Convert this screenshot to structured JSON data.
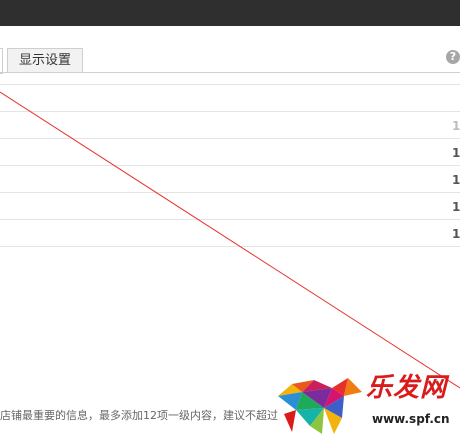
{
  "tabs": {
    "display_settings_label": "显示设置"
  },
  "help": {
    "glyph": "?"
  },
  "rows": [
    {
      "number": "1",
      "faint": true
    },
    {
      "number": "1",
      "faint": false
    },
    {
      "number": "1",
      "faint": false
    },
    {
      "number": "1",
      "faint": false
    },
    {
      "number": "1",
      "faint": false
    }
  ],
  "footer": {
    "hint": "店铺最重要的信息，最多添加12项一级内容，建议不超过"
  },
  "watermark": {
    "logo_text": "乐发网",
    "url": "www.spf.cn"
  },
  "colors": {
    "topbar": "#2f2f2f",
    "tab_border": "#cfcfcf",
    "red_annotation": "#e8302a",
    "watermark_red": "#d91b1b"
  }
}
